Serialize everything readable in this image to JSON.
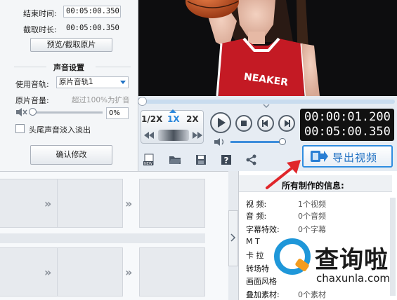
{
  "settings": {
    "end_time_label": "结束时间:",
    "end_time_value": "00:05:00.350",
    "clip_duration_label": "截取时长:",
    "clip_duration_value": "00:05:00.350",
    "preview_button": "预览/截取原片",
    "audio_section_title": "声音设置",
    "use_track_label": "使用音轨:",
    "use_track_value": "原片音轨1",
    "original_volume_label": "原片音量:",
    "volume_hint": "超过100%为扩音",
    "volume_value": "0%",
    "volume_level_percent": 0,
    "fade_checkbox_label": "头尾声音淡入淡出",
    "confirm_button": "确认修改"
  },
  "player": {
    "speed_options": [
      "1/2X",
      "1X",
      "2X"
    ],
    "selected_speed": "1X",
    "current_time": "00:00:01.200",
    "total_time": "00:05:00.350",
    "progress_fraction": 0.004,
    "volume_fraction": 1.0,
    "icons": [
      "play-icon",
      "stop-icon",
      "previous-icon",
      "next-icon",
      "rewind-icon",
      "fast-forward-icon",
      "volume-icon"
    ]
  },
  "toolbar": {
    "icons": [
      "new-icon",
      "open-folder-icon",
      "save-icon",
      "help-icon",
      "share-icon"
    ],
    "export_button": "导出视频"
  },
  "info_panel": {
    "title": "所有制作的信息:",
    "rows": [
      {
        "label": "视    频:",
        "value": "1个视频"
      },
      {
        "label": "音    频:",
        "value": "0个音频"
      },
      {
        "label": "字幕特效:",
        "value": "0个字幕"
      },
      {
        "label": "M    T",
        "value": ""
      },
      {
        "label": "卡  拉",
        "value": ""
      },
      {
        "label": "转场特",
        "value": ""
      },
      {
        "label": "画面风格",
        "value": ""
      },
      {
        "label": "叠加素材:",
        "value": "0个素材"
      }
    ]
  },
  "watermark": {
    "cn": "查询啦",
    "en": "chaxunla.com"
  },
  "colors": {
    "accent": "#1f72c4",
    "export_border": "#2f8de0",
    "annotation": "#e0262a",
    "watermark_blue": "#1f97d9",
    "watermark_orange": "#f39c1f"
  }
}
